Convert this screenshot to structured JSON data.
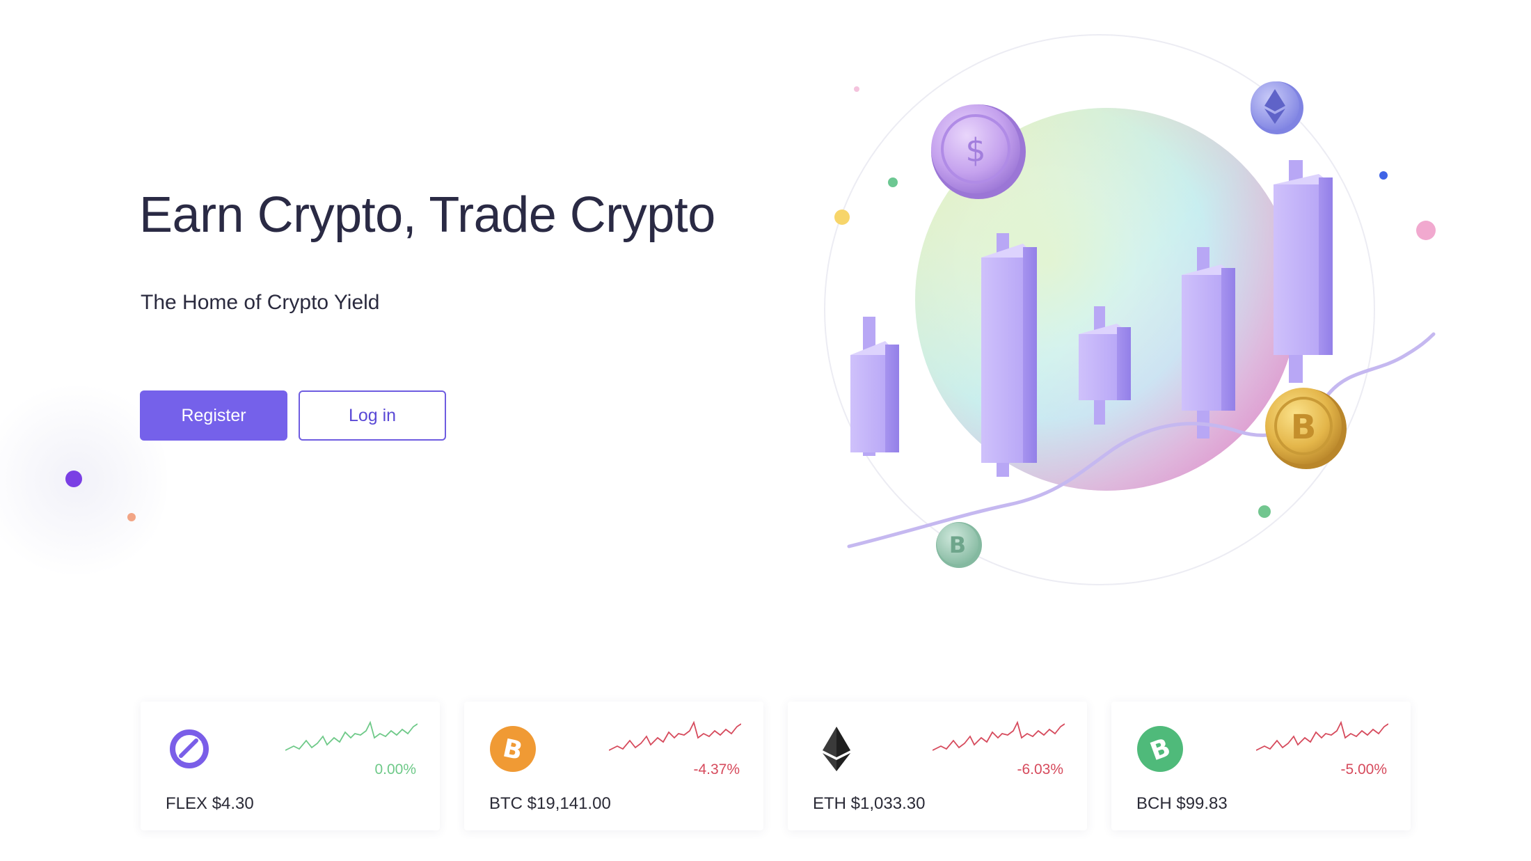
{
  "hero": {
    "title": "Earn Crypto, Trade Crypto",
    "subtitle": "The Home of Crypto Yield",
    "register_label": "Register",
    "login_label": "Log in"
  },
  "colors": {
    "primary": "#7561ea",
    "up": "#6ec988",
    "down": "#d64a5c"
  },
  "tickers": [
    {
      "symbol": "FLEX",
      "price": "$4.30",
      "label": "FLEX $4.30",
      "change": "0.00%",
      "icon": "flex-coin-icon",
      "trend": "flat"
    },
    {
      "symbol": "BTC",
      "price": "$19,141.00",
      "label": "BTC $19,141.00",
      "change": "-4.37%",
      "icon": "bitcoin-icon",
      "trend": "down"
    },
    {
      "symbol": "ETH",
      "price": "$1,033.30",
      "label": "ETH $1,033.30",
      "change": "-6.03%",
      "icon": "ethereum-icon",
      "trend": "down"
    },
    {
      "symbol": "BCH",
      "price": "$99.83",
      "label": "BCH $99.83",
      "change": "-5.00%",
      "icon": "bitcoin-cash-icon",
      "trend": "down"
    }
  ]
}
